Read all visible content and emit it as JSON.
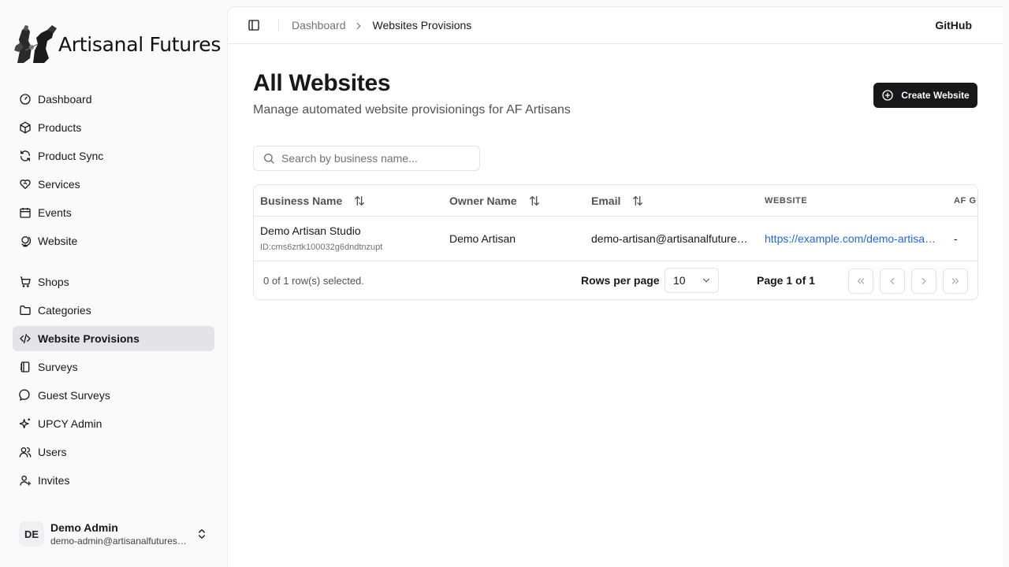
{
  "sidebar": {
    "brand": "Artisanal Futures",
    "nav_primary": [
      {
        "label": "Dashboard",
        "icon": "gauge-icon"
      },
      {
        "label": "Products",
        "icon": "package-icon"
      },
      {
        "label": "Product Sync",
        "icon": "refresh-icon"
      },
      {
        "label": "Services",
        "icon": "heart-handshake-icon"
      },
      {
        "label": "Events",
        "icon": "calendar-icon"
      },
      {
        "label": "Website",
        "icon": "globe-icon"
      }
    ],
    "nav_secondary": [
      {
        "label": "Shops",
        "icon": "cart-icon"
      },
      {
        "label": "Categories",
        "icon": "folder-icon"
      },
      {
        "label": "Website Provisions",
        "icon": "code-icon",
        "active": true
      },
      {
        "label": "Surveys",
        "icon": "notebook-icon"
      },
      {
        "label": "Guest Surveys",
        "icon": "message-circle-icon"
      },
      {
        "label": "UPCY Admin",
        "icon": "sparkles-icon"
      },
      {
        "label": "Users",
        "icon": "users-icon"
      },
      {
        "label": "Invites",
        "icon": "user-plus-icon"
      }
    ],
    "user": {
      "initials": "DE",
      "name": "Demo Admin",
      "email": "demo-admin@artisanalfutures.org"
    }
  },
  "header": {
    "breadcrumb": [
      "Dashboard",
      "Websites Provisions"
    ],
    "github": "GitHub"
  },
  "page": {
    "title": "All Websites",
    "subtitle": "Manage automated website provisionings for AF Artisans",
    "create_button": "Create Website",
    "search_placeholder": "Search by business name..."
  },
  "table": {
    "columns": [
      "Business Name",
      "Owner Name",
      "Email",
      "WEBSITE",
      "AF G"
    ],
    "rows": [
      {
        "business_name": "Demo Artisan Studio",
        "id": "ID:cms6zrtk100032g6dndtnzupt",
        "owner_name": "Demo Artisan",
        "email": "demo-artisan@artisanalfutures.org",
        "website": "https://example.com/demo-artisan-studio",
        "af": "-"
      }
    ],
    "selection_text": "0 of 1 row(s) selected.",
    "rows_per_page_label": "Rows per page",
    "rows_per_page_value": "10",
    "page_info": "Page 1 of 1"
  },
  "colors": {
    "primary": "#18181b",
    "link": "#2563eb",
    "active_nav": "#e4e4e7"
  }
}
